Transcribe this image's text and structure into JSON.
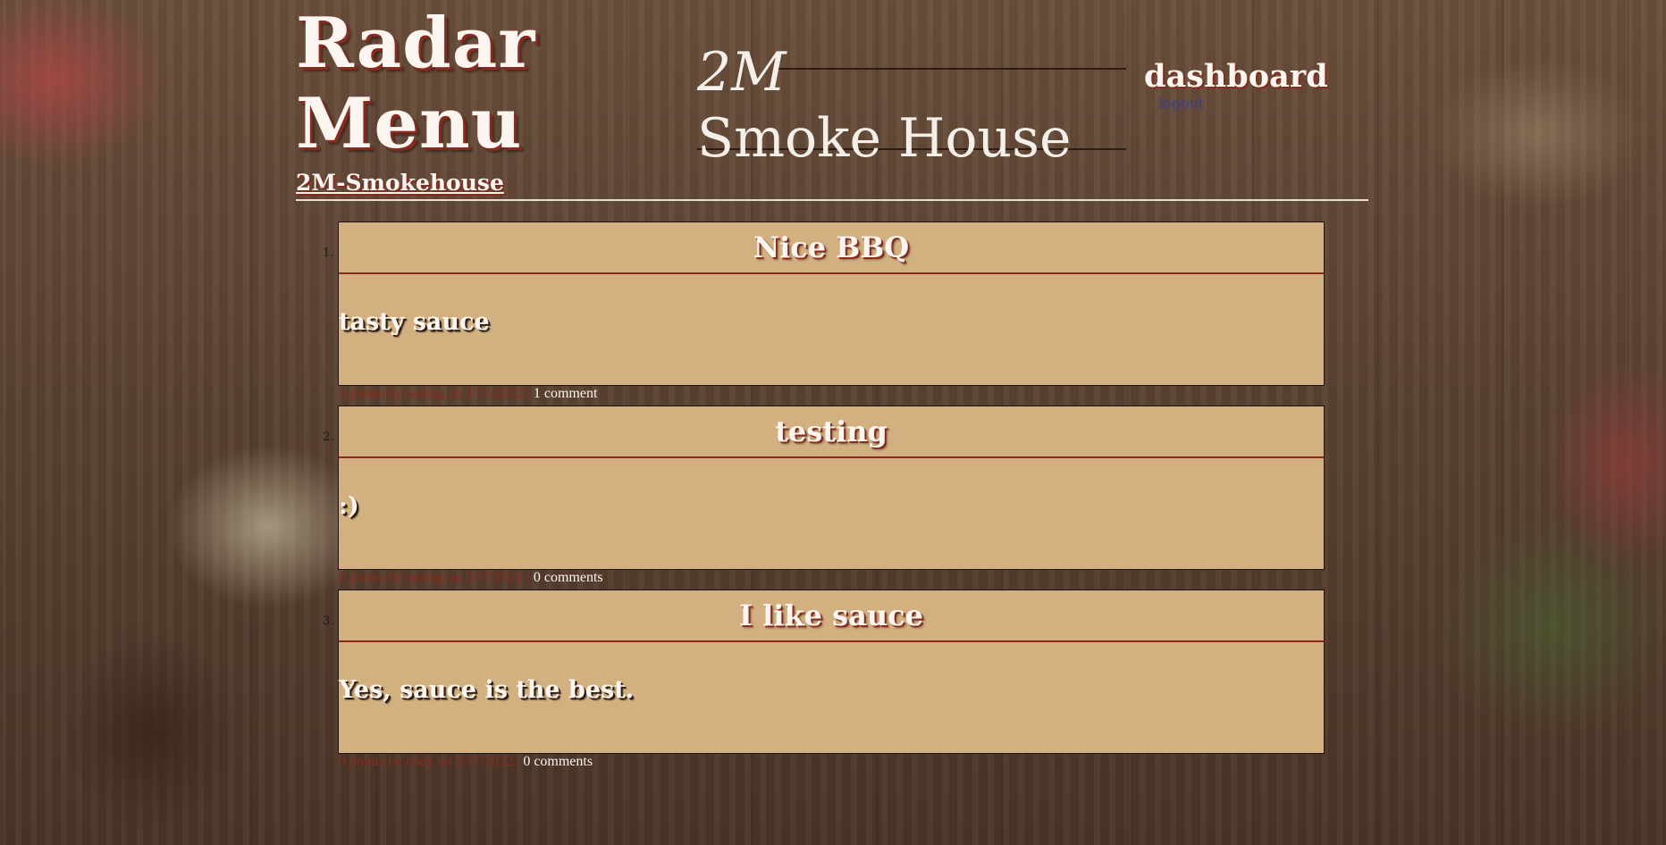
{
  "header": {
    "brand_title_line1": "Radar",
    "brand_title_line2": "Menu",
    "brand_subtitle": "2M-Smokehouse",
    "logo_monogram": "2M",
    "logo_name": "Smoke House",
    "nav_dashboard": "dashboard",
    "nav_logout": "logout"
  },
  "posts": [
    {
      "number": "1.",
      "title": "Nice BBQ",
      "text": "tasty sauce",
      "meta_prefix": "3 points by testing on 5/17/2022 | ",
      "comments_link": "1 comment"
    },
    {
      "number": "2.",
      "title": "testing",
      "text": ":)",
      "meta_prefix": "0 points by testing on 5/17/2022 | ",
      "comments_link": "0 comments"
    },
    {
      "number": "3.",
      "title": "I like sauce",
      "text": "Yes, sauce is the best.",
      "meta_prefix": "0 points by cody on 5/17/2022 | ",
      "comments_link": "0 comments"
    }
  ],
  "colors": {
    "card_background": "#d2b07f",
    "accent_red": "#8a2a1e",
    "title_text": "#fdf5ef",
    "logout_link": "#3a3f8e"
  }
}
